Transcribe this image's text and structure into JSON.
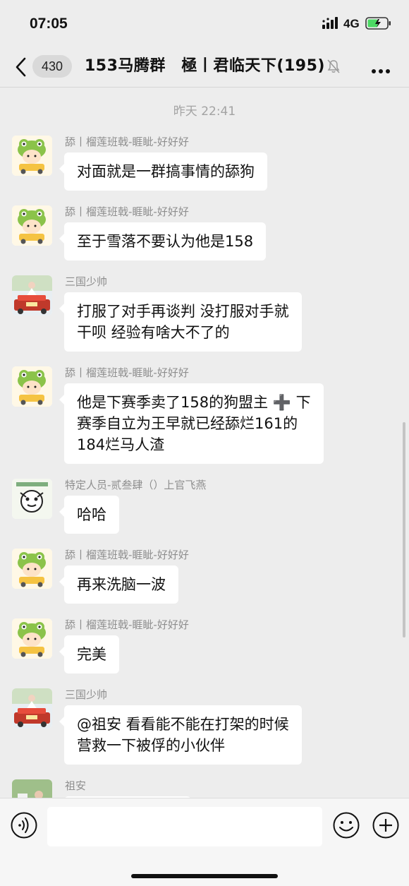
{
  "status_bar": {
    "time": "07:05",
    "network": "4G",
    "icons": [
      "signal-icon",
      "battery-charging-icon"
    ]
  },
  "nav": {
    "unread_count": "430",
    "title": "153马腾群　極丨君临天下(195)",
    "icons": [
      "back-icon",
      "mute-icon",
      "more-icon"
    ]
  },
  "chat": {
    "timestamp": "昨天 22:41",
    "messages": [
      {
        "sender": "舔丨榴莲班戟-睚眦-好好好",
        "text": "对面就是一群搞事情的舔狗",
        "avatar": "frog-avatar"
      },
      {
        "sender": "舔丨榴莲班戟-睚眦-好好好",
        "text": "至于雪落不要认为他是158",
        "avatar": "frog-avatar"
      },
      {
        "sender": "三国少帅",
        "text": "打服了对手再谈判 没打服对手就\n干呗 经验有啥大不了的",
        "avatar": "wedding-car-avatar"
      },
      {
        "sender": "舔丨榴莲班戟-睚眦-好好好",
        "text": "他是下赛季卖了158的狗盟主 ➕ 下\n赛季自立为王早就已经舔烂161的\n184烂马人渣",
        "avatar": "frog-avatar"
      },
      {
        "sender": "特定人员-贰叁肆（）上官飞燕",
        "text": "哈哈",
        "avatar": "sticker-avatar"
      },
      {
        "sender": "舔丨榴莲班戟-睚眦-好好好",
        "text": "再来洗脑一波",
        "avatar": "frog-avatar"
      },
      {
        "sender": "舔丨榴莲班戟-睚眦-好好好",
        "text": "完美",
        "avatar": "frog-avatar"
      },
      {
        "sender": "三国少帅",
        "text": "@祖安 看看能不能在打架的时候\n营救一下被俘的小伙伴",
        "avatar": "wedding-car-avatar"
      },
      {
        "sender": "祖安",
        "text": "",
        "avatar": "photo-avatar"
      }
    ]
  },
  "input_bar": {
    "placeholder": "",
    "icons": [
      "voice-icon",
      "emoji-icon",
      "plus-icon"
    ]
  },
  "colors": {
    "background": "#ededed",
    "bubble": "#ffffff",
    "sender_text": "#8e8e8e",
    "timestamp_text": "#a3a3a3",
    "battery_fill": "#4cd964"
  }
}
